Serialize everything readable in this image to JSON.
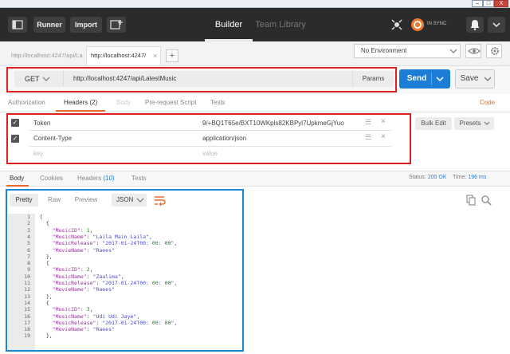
{
  "window": {
    "minimize": "–",
    "maximize": "□",
    "close": "X"
  },
  "topbar": {
    "runner": "Runner",
    "import": "Import",
    "builder": "Builder",
    "team_library": "Team Library",
    "sync_status": "IN SYNC"
  },
  "tabs": [
    {
      "label": "http://localhost:4247/api/La"
    },
    {
      "label": "http://localhost:4247/"
    }
  ],
  "add_tab": "+",
  "environment": {
    "value": "No Environment"
  },
  "request": {
    "method": "GET",
    "url": "http://localhost:4247/api/LatestMusic",
    "params_label": "Params",
    "send_label": "Send",
    "save_label": "Save"
  },
  "subtabs": {
    "authorization": "Authorization",
    "headers": "Headers (2)",
    "body": "Body",
    "prerequest": "Pre-request Script",
    "tests": "Tests",
    "code": "Code"
  },
  "headers": {
    "rows": [
      {
        "key": "Token",
        "value": "9/+BQ1T65e/BXT10WKpls82KBPyl7UpkmeGjYuo"
      },
      {
        "key": "Content-Type",
        "value": "application/json"
      }
    ],
    "key_placeholder": "key",
    "value_placeholder": "value",
    "bulk_edit": "Bulk Edit",
    "presets": "Presets"
  },
  "response": {
    "tabs": {
      "body": "Body",
      "cookies": "Cookies",
      "headers": "Headers",
      "headers_count": "(10)",
      "tests": "Tests"
    },
    "status_label": "Status:",
    "status_value": "200 OK",
    "time_label": "Time:",
    "time_value": "196 ms",
    "view_pretty": "Pretty",
    "view_raw": "Raw",
    "view_preview": "Preview",
    "format": "JSON",
    "line_numbers": [
      "1",
      "2",
      "3",
      "4",
      "5",
      "6",
      "7",
      "8",
      "9",
      "10",
      "11",
      "12",
      "13",
      "14",
      "15",
      "16",
      "17",
      "18",
      "19"
    ],
    "code_lines": [
      "[",
      "  {",
      "    \"MusicID\": 1,",
      "    \"MusicName\": \"Laila Main Laila\",",
      "    \"MusicRelease\": \"2017-01-24T00:00:00\",",
      "    \"MovieName\": \"Raees\"",
      "  },",
      "  {",
      "    \"MusicID\": 2,",
      "    \"MusicName\": \"Zaalima\",",
      "    \"MusicRelease\": \"2017-01-24T00:00:00\",",
      "    \"MovieName\": \"Raees\"",
      "  },",
      "  {",
      "    \"MusicID\": 3,",
      "    \"MusicName\": \"Udi Udi Jaye\",",
      "    \"MusicRelease\": \"2017-01-24T00:00:00\",",
      "    \"MovieName\": \"Raees\"",
      "  },"
    ]
  }
}
